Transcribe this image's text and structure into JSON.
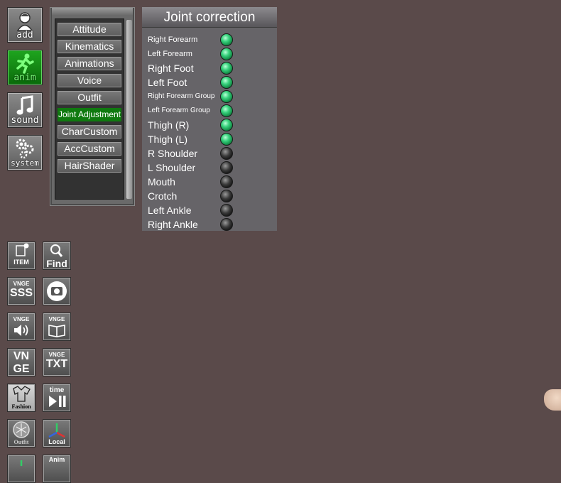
{
  "sidebar": {
    "buttons": [
      {
        "label": "add",
        "icon": "person-icon",
        "active": false
      },
      {
        "label": "anim",
        "icon": "running-figure-icon",
        "active": true
      },
      {
        "label": "sound",
        "icon": "music-note-icon",
        "active": false
      },
      {
        "label": "system",
        "icon": "gears-icon",
        "active": false
      }
    ]
  },
  "menu": {
    "items": [
      "Attitude",
      "Kinematics",
      "Animations",
      "Voice",
      "Outfit",
      "Joint Adjustment",
      "CharCustom",
      "AccCustom",
      "HairShader"
    ],
    "selected": "Joint Adjustment"
  },
  "joint_panel": {
    "title": "Joint correction",
    "rows": [
      {
        "label": "Right Forearm",
        "on": true
      },
      {
        "label": "Left Forearm",
        "on": true
      },
      {
        "label": "Right Foot",
        "on": true
      },
      {
        "label": "Left Foot",
        "on": true
      },
      {
        "label": "Right Forearm Group",
        "on": true
      },
      {
        "label": "Left Forearm Group",
        "on": true
      },
      {
        "label": "Thigh (R)",
        "on": true
      },
      {
        "label": "Thigh (L)",
        "on": true
      },
      {
        "label": "R Shoulder",
        "on": false
      },
      {
        "label": "L Shoulder",
        "on": false
      },
      {
        "label": "Mouth",
        "on": false
      },
      {
        "label": "Crotch",
        "on": false
      },
      {
        "label": "Left Ankle",
        "on": false
      },
      {
        "label": "Right Ankle",
        "on": false
      }
    ]
  },
  "tools": {
    "item": "ITEM",
    "find": "Find",
    "vnge_sss_top": "VNGE",
    "vnge_sss": "SSS",
    "vnge_audio_top": "VNGE",
    "vnge_book_top": "VNGE",
    "vnge_top": "VN",
    "vnge_bottom": "GE",
    "vnge_txt_top": "VNGE",
    "vnge_txt": "TXT",
    "fashion": "Fashion",
    "time": "time",
    "outfit": "Outfit",
    "local": "Local",
    "anim": "Anim"
  },
  "colors": {
    "background": "#5a4a4a",
    "active_green": "#0f7a0f",
    "led_on": "#38d27d",
    "led_off": "#3a3a3a"
  }
}
